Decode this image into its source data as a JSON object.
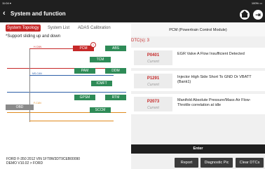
{
  "status_bar": {
    "time": "11:04 ▾",
    "battery": "100% ▭"
  },
  "header": {
    "back_icon": "chevron-left-icon",
    "title": "System and function",
    "home_icon": "home-icon",
    "exit_icon": "exit-icon"
  },
  "tabs": [
    {
      "label": "System Topology",
      "active": true
    },
    {
      "label": "System List",
      "active": false
    },
    {
      "label": "ADAS Calibration",
      "active": false
    }
  ],
  "hint": "*Support sliding up and down",
  "topology": {
    "buses": [
      {
        "label": "H-CAN",
        "color": "#c62828"
      },
      {
        "label": "MS-CAN",
        "color": "#2e5fa8"
      },
      {
        "label": "F-CAN",
        "color": "#e08a1e"
      }
    ],
    "gateway": "OBD",
    "nodes": [
      "PCM",
      "ABS",
      "TCM",
      "PAM",
      "DDM",
      "ICMFT",
      "GPSM",
      "RTM",
      "SCCM"
    ],
    "pcm_badge": "1"
  },
  "vehicle_info": {
    "line1": "FORD  F-350  2012  VIN  1FT8W3DT9CEB00090",
    "line2": "DEMO V10.02 > FORD"
  },
  "module": {
    "title": "PCM (Powertrain Control Module)",
    "dtc_count": "DTC(s): 3"
  },
  "dtcs": [
    {
      "code": "P0401",
      "state": "Current",
      "desc": "EGR Valve A Flow Insufficient Detected"
    },
    {
      "code": "P1291",
      "state": "Current",
      "desc": "Injector High Side Short To GND Or VBATT (Bank1)"
    },
    {
      "code": "P2073",
      "state": "Current",
      "desc": "Manifold Absolute Pressure/Mass Air Flow-Throttle correlation at idle"
    }
  ],
  "buttons": {
    "enter": "Enter",
    "report": "Report",
    "diag_pic": "Diagnostic Pic",
    "clear": "Clear DTCs"
  },
  "colors": {
    "accent": "#c62828",
    "node_green": "#2e8b57",
    "node_red": "#c62828"
  }
}
